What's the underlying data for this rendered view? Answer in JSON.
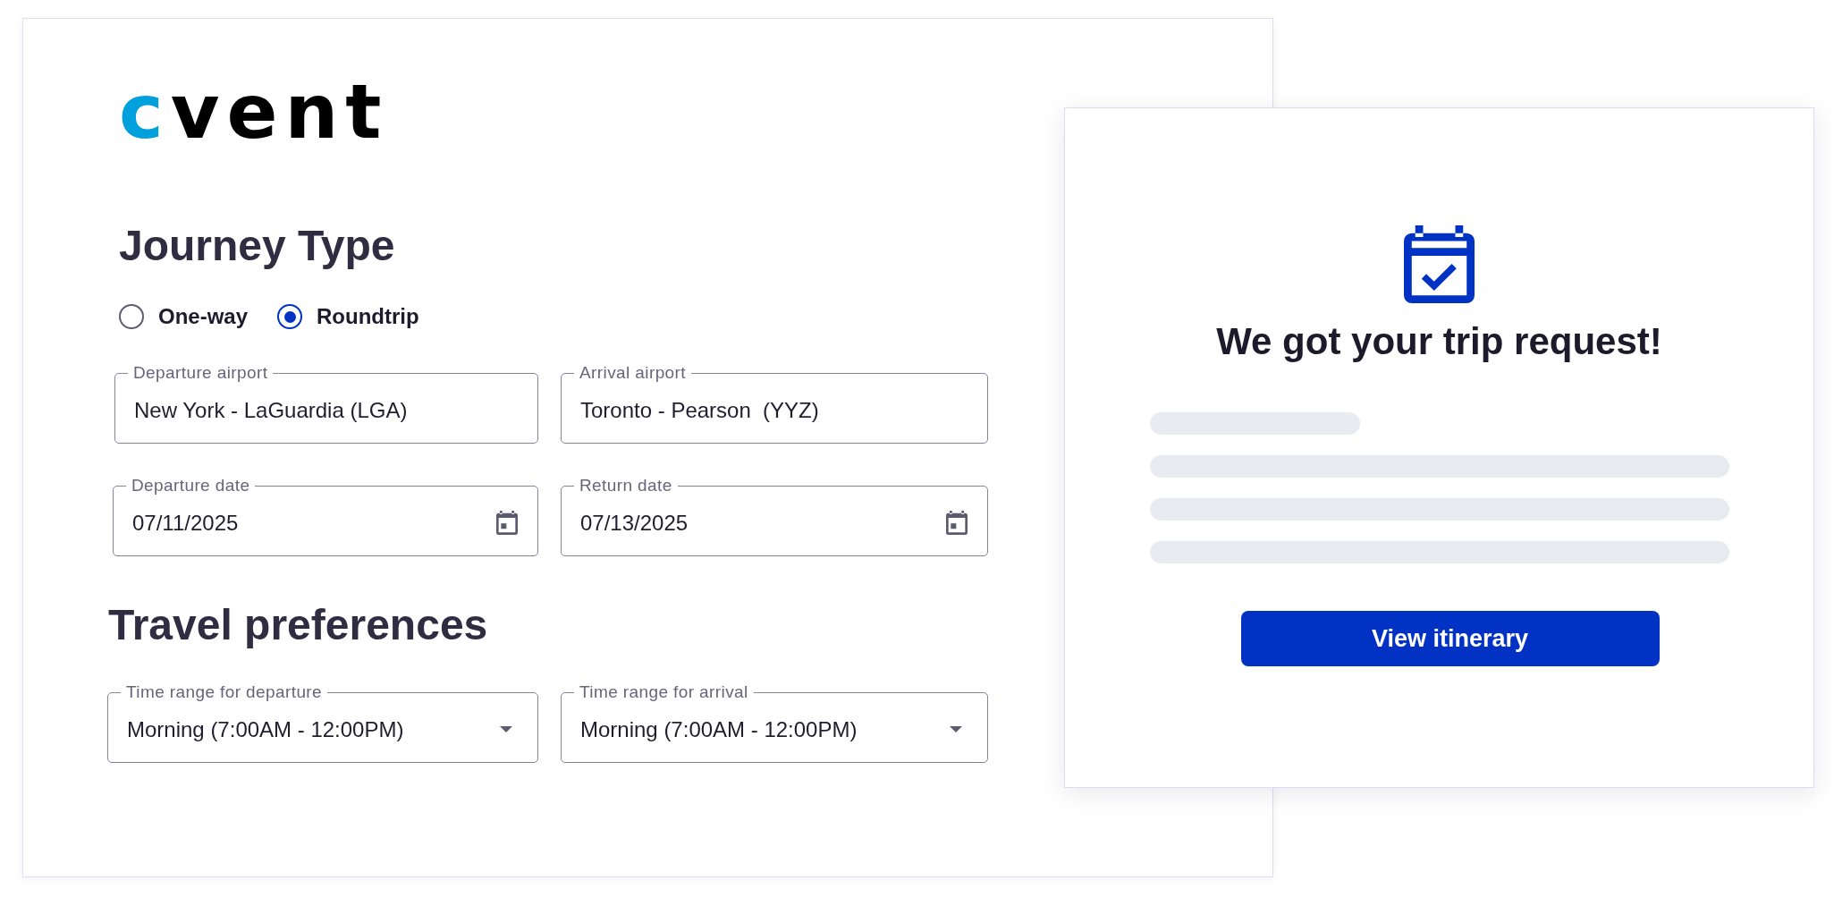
{
  "logo": {
    "text": "cvent"
  },
  "journey_type": {
    "title": "Journey Type",
    "options": [
      {
        "label": "One-way",
        "selected": false
      },
      {
        "label": "Roundtrip",
        "selected": true
      }
    ]
  },
  "trip_fields": [
    {
      "kind": "text",
      "label": "Departure airport",
      "value": "New York - LaGuardia (LGA)"
    },
    {
      "kind": "text",
      "label": "Arrival airport",
      "value": "Toronto - Pearson  (YYZ)"
    },
    {
      "kind": "date",
      "label": "Departure date",
      "value": "07/11/2025"
    },
    {
      "kind": "date",
      "label": "Return date",
      "value": "07/13/2025"
    }
  ],
  "travel_preferences": {
    "title": "Travel preferences",
    "fields": [
      {
        "kind": "select",
        "label": "Time range for departure",
        "value": "Morning (7:00AM - 12:00PM)"
      },
      {
        "kind": "select",
        "label": "Time range for arrival",
        "value": "Morning (7:00AM - 12:00PM)"
      }
    ]
  },
  "confirmation": {
    "title": "We got your trip request!",
    "button": "View itinerary"
  }
}
